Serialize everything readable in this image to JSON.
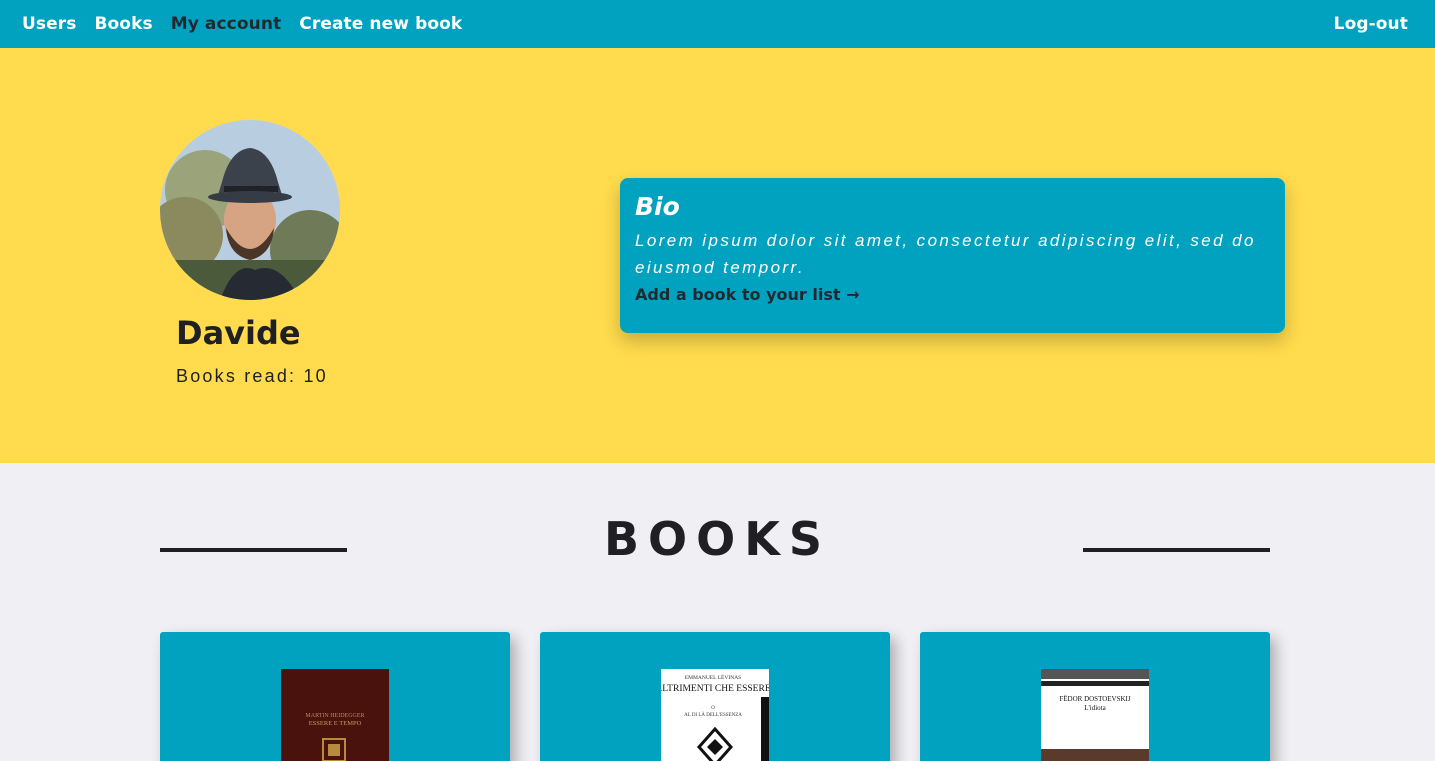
{
  "nav": {
    "links": [
      "Users",
      "Books",
      "My account",
      "Create new book"
    ],
    "logout": "Log-out"
  },
  "profile": {
    "name": "Davide",
    "books_read": "Books read: 10"
  },
  "bio": {
    "title": "Bio",
    "text": "Lorem ipsum dolor sit amet, consectetur adipiscing elit, sed do eiusmod temporr.",
    "link": "Add a book to your list →"
  },
  "books_section": {
    "title": "BOOKS",
    "covers": [
      {
        "author": "MARTIN HEIDEGGER",
        "title": "ESSERE E TEMPO"
      },
      {
        "author": "EMMANUEL LÉVINAS",
        "title": "ALTRIMENTI CHE ESSERE",
        "subtitle1": "O",
        "subtitle2": "AL DI LÀ DELL'ESSENZA"
      },
      {
        "author": "FËDOR DOSTOEVSKIJ",
        "title": "L'idiota"
      }
    ]
  },
  "colors": {
    "accent": "#00a2bf",
    "hero": "#ffdb4d",
    "background": "#f0f0f4",
    "dark": "#1f1f24"
  }
}
